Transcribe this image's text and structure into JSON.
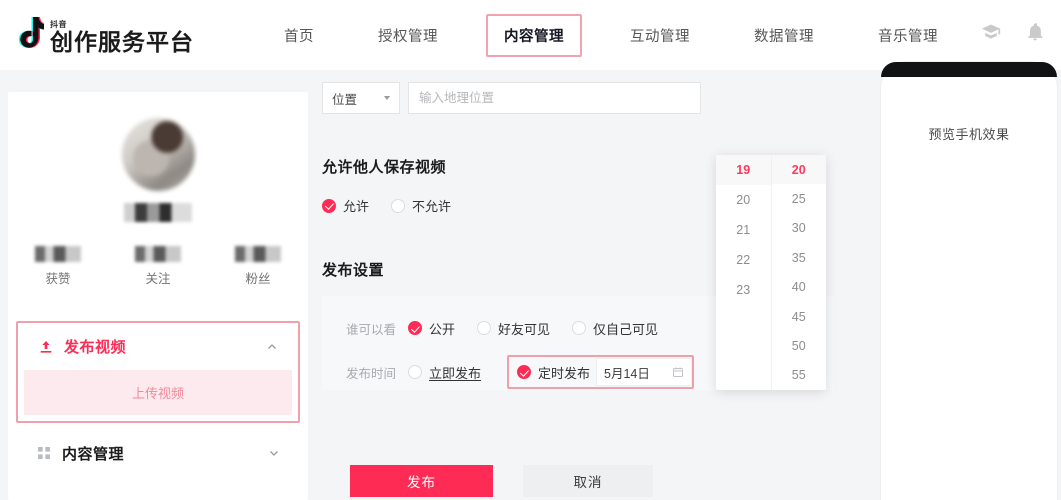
{
  "header": {
    "brand_sub": "抖音",
    "brand_title": "创作服务平台",
    "nav": [
      {
        "label": "首页",
        "active": false
      },
      {
        "label": "授权管理",
        "active": false
      },
      {
        "label": "内容管理",
        "active": true
      },
      {
        "label": "互动管理",
        "active": false
      },
      {
        "label": "数据管理",
        "active": false
      },
      {
        "label": "音乐管理",
        "active": false
      }
    ],
    "icons": [
      {
        "name": "graduation-cap-icon"
      },
      {
        "name": "bell-icon"
      }
    ]
  },
  "sidebar": {
    "stats": [
      {
        "label": "获赞"
      },
      {
        "label": "关注"
      },
      {
        "label": "粉丝"
      }
    ],
    "menu": {
      "publish_video": "发布视频",
      "upload_video": "上传视频",
      "content_management": "内容管理"
    }
  },
  "main": {
    "location": {
      "select_label": "位置",
      "input_value": "",
      "input_placeholder": "输入地理位置"
    },
    "allow_save": {
      "title": "允许他人保存视频",
      "options": [
        {
          "label": "允许",
          "selected": true
        },
        {
          "label": "不允许",
          "selected": false
        }
      ]
    },
    "publish_settings": {
      "title": "发布设置",
      "visibility": {
        "key": "谁可以看",
        "options": [
          {
            "label": "公开",
            "selected": true
          },
          {
            "label": "好友可见",
            "selected": false
          },
          {
            "label": "仅自己可见",
            "selected": false
          }
        ]
      },
      "publish_time": {
        "key": "发布时间",
        "options": [
          {
            "label": "立即发布",
            "selected": false
          },
          {
            "label": "定时发布",
            "selected": true
          }
        ],
        "date_value": "5月14日"
      }
    },
    "time_picker": {
      "hours": [
        {
          "value": "19",
          "selected": true
        },
        {
          "value": "20",
          "selected": false
        },
        {
          "value": "21",
          "selected": false
        },
        {
          "value": "22",
          "selected": false
        },
        {
          "value": "23",
          "selected": false
        }
      ],
      "minutes": [
        {
          "value": "20",
          "selected": true
        },
        {
          "value": "25",
          "selected": false
        },
        {
          "value": "30",
          "selected": false
        },
        {
          "value": "35",
          "selected": false
        },
        {
          "value": "40",
          "selected": false
        },
        {
          "value": "45",
          "selected": false
        },
        {
          "value": "50",
          "selected": false
        },
        {
          "value": "55",
          "selected": false
        }
      ]
    },
    "actions": {
      "publish": "发布",
      "cancel": "取消"
    }
  },
  "preview": {
    "label": "预览手机效果"
  },
  "colors": {
    "accent_red": "#fe2c55",
    "accent_pink_border": "#f0a0ab",
    "submenu_bg": "#fdeaee",
    "panel_bg": "#f7f8fa",
    "page_bg": "#f4f5f7"
  }
}
